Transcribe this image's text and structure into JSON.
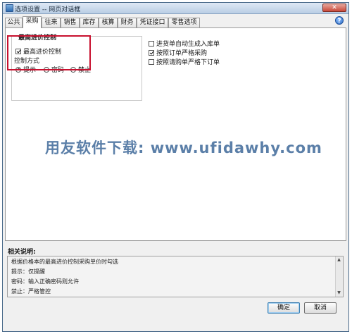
{
  "window": {
    "title": "选项设置 -- 网页对话框",
    "close_label": "✕"
  },
  "tabs": [
    {
      "label": "公共",
      "active": false
    },
    {
      "label": "采购",
      "active": true
    },
    {
      "label": "往来",
      "active": false
    },
    {
      "label": "销售",
      "active": false
    },
    {
      "label": "库存",
      "active": false
    },
    {
      "label": "核算",
      "active": false
    },
    {
      "label": "财务",
      "active": false
    },
    {
      "label": "凭证接口",
      "active": false
    },
    {
      "label": "零售选项",
      "active": false
    }
  ],
  "help": {
    "label": "?",
    "icon": "help-icon"
  },
  "price_control": {
    "group_title": "最高进价控制",
    "checkbox_label": "最高进价控制",
    "checkbox_checked": true,
    "mode_label": "控制方式",
    "options": [
      {
        "label": "提示",
        "selected": true
      },
      {
        "label": "密码",
        "selected": false
      },
      {
        "label": "禁止",
        "selected": false
      }
    ]
  },
  "right_options": [
    {
      "label": "进货单自动生成入库单",
      "checked": false
    },
    {
      "label": "按照订单严格采购",
      "checked": true
    },
    {
      "label": "按照请购单严格下订单",
      "checked": false
    }
  ],
  "watermark": "用友软件下载: www.ufidawhy.com",
  "description": {
    "label": "相关说明:",
    "lines": [
      "根据价格本的最高进价控制采购单价时勾选",
      "提示：仅提醒",
      "密码：输入正确密码则允许",
      "禁止：严格管控"
    ]
  },
  "buttons": {
    "ok": "确定",
    "cancel": "取消"
  },
  "colors": {
    "highlight": "#c8102e",
    "watermark": "#5b7fa8"
  }
}
